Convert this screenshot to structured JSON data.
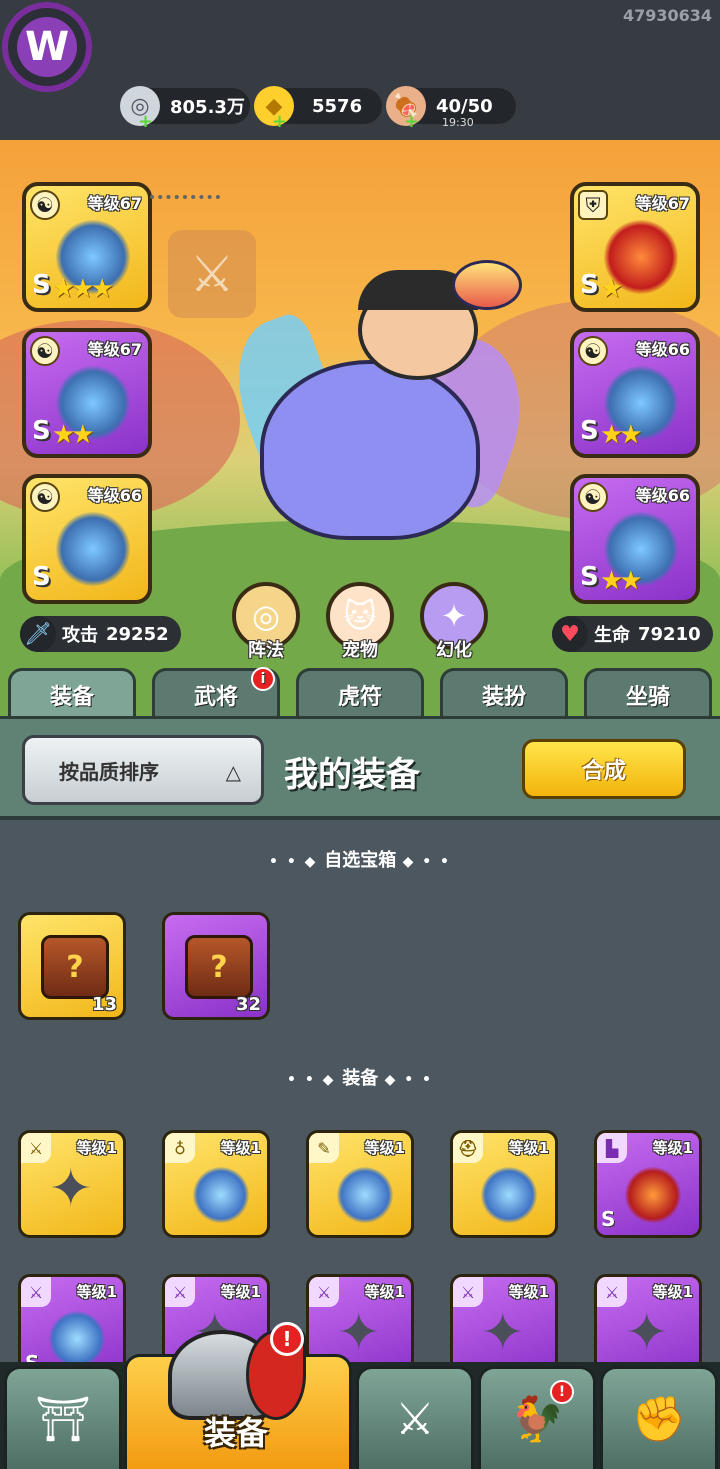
{
  "header": {
    "uid": "47930634",
    "logo_letter": "W",
    "resources": [
      {
        "name": "silver",
        "icon": "silver-coin-icon",
        "glyph": "◎",
        "value": "805.3万",
        "sub": ""
      },
      {
        "name": "gold",
        "icon": "gold-ingot-icon",
        "glyph": "◆",
        "value": "5576",
        "sub": ""
      },
      {
        "name": "stamina",
        "icon": "meat-leg-icon",
        "glyph": "🍖",
        "value": "40/50",
        "sub": "19:30"
      }
    ]
  },
  "scene": {
    "left_slots": [
      {
        "level": "等级67",
        "rarity": "gold",
        "grade": "S",
        "stars": "★★★",
        "type_icon": "yin-yang-icon"
      },
      {
        "level": "等级67",
        "rarity": "purple",
        "grade": "S",
        "stars": "★★",
        "type_icon": "yin-yang-icon"
      },
      {
        "level": "等级66",
        "rarity": "gold",
        "grade": "S",
        "stars": "",
        "type_icon": "yin-yang-icon"
      }
    ],
    "right_slots": [
      {
        "level": "等级67",
        "rarity": "gold",
        "grade": "S",
        "stars": "★",
        "type_icon": "armor-icon"
      },
      {
        "level": "等级66",
        "rarity": "purple",
        "grade": "S",
        "stars": "★★",
        "type_icon": "yin-yang-icon"
      },
      {
        "level": "等级66",
        "rarity": "purple",
        "grade": "S",
        "stars": "★★",
        "type_icon": "yin-yang-icon"
      }
    ],
    "attack_label": "攻击",
    "attack_value": "29252",
    "life_label": "生命",
    "life_value": "79210",
    "circle_buttons": [
      {
        "label": "阵法",
        "icon": "formation-icon"
      },
      {
        "label": "宠物",
        "icon": "pet-cat-icon"
      },
      {
        "label": "幻化",
        "icon": "transform-icon"
      }
    ]
  },
  "tabs": [
    {
      "label": "装备",
      "active": true,
      "badge": ""
    },
    {
      "label": "武将",
      "active": false,
      "badge": "i"
    },
    {
      "label": "虎符",
      "active": false,
      "badge": ""
    },
    {
      "label": "装扮",
      "active": false,
      "badge": ""
    },
    {
      "label": "坐骑",
      "active": false,
      "badge": ""
    }
  ],
  "sortbar": {
    "sort_label": "按品质排序",
    "sort_arrow": "△",
    "title": "我的装备",
    "merge_label": "合成"
  },
  "inventory": {
    "chest_section_title": "自选宝箱",
    "chests": [
      {
        "rarity": "gold",
        "count": "13",
        "glyph": "?"
      },
      {
        "rarity": "purple",
        "count": "32",
        "glyph": "?"
      }
    ],
    "equip_section_title": "装备",
    "row1": [
      {
        "rarity": "gold",
        "level": "等级1",
        "type_icon": "weapon-icon",
        "art": "shuriken",
        "grade": ""
      },
      {
        "rarity": "gold",
        "level": "等级1",
        "type_icon": "medal-icon",
        "art": "gear",
        "grade": ""
      },
      {
        "rarity": "gold",
        "level": "等级1",
        "type_icon": "token-icon",
        "art": "gear",
        "grade": ""
      },
      {
        "rarity": "gold",
        "level": "等级1",
        "type_icon": "helmet-icon",
        "art": "gear",
        "grade": ""
      },
      {
        "rarity": "purple",
        "level": "等级1",
        "type_icon": "boot-icon",
        "art": "gear-red",
        "grade": "S"
      }
    ],
    "row2": [
      {
        "rarity": "purple",
        "level": "等级1",
        "type_icon": "weapon-icon",
        "art": "gear",
        "grade": "S"
      },
      {
        "rarity": "purple",
        "level": "等级1",
        "type_icon": "weapon-icon",
        "art": "shuriken",
        "grade": ""
      },
      {
        "rarity": "purple",
        "level": "等级1",
        "type_icon": "weapon-icon",
        "art": "shuriken",
        "grade": ""
      },
      {
        "rarity": "purple",
        "level": "等级1",
        "type_icon": "weapon-icon",
        "art": "shuriken",
        "grade": ""
      },
      {
        "rarity": "purple",
        "level": "等级1",
        "type_icon": "weapon-icon",
        "art": "shuriken",
        "grade": ""
      }
    ]
  },
  "bottom_nav": {
    "active_label": "装备",
    "items": [
      {
        "icon": "palace-gate-icon",
        "glyph": "⛩"
      },
      {
        "icon": "equipment-helmet-icon",
        "glyph": ""
      },
      {
        "icon": "crossed-swords-icon",
        "glyph": "⚔"
      },
      {
        "icon": "bird-mount-icon",
        "glyph": "🐓"
      },
      {
        "icon": "fist-upgrade-icon",
        "glyph": "✊"
      }
    ],
    "alert_glyph": "!"
  },
  "colors": {
    "gold_rarity": "#f2b71a",
    "purple_rarity": "#8a32c9",
    "panel_green": "#5f8275",
    "accent_yellow": "#ffd21d"
  }
}
